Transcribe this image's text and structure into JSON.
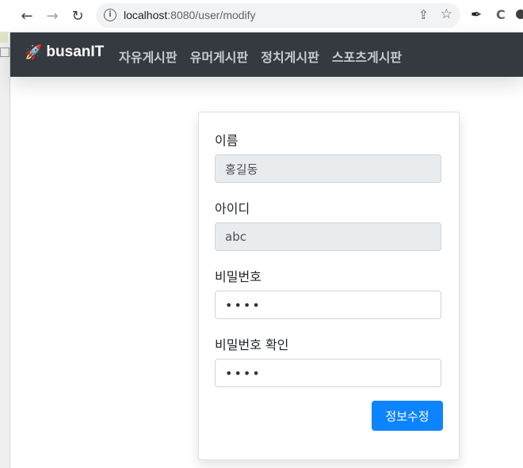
{
  "browser": {
    "url_host": "localhost",
    "url_rest": ":8080/user/modify"
  },
  "navbar": {
    "brand": "busanIT",
    "links": [
      "자유게시판",
      "유머게시판",
      "정치게시판",
      "스포츠게시판"
    ]
  },
  "form": {
    "name_label": "이름",
    "name_value": "홍길동",
    "id_label": "아이디",
    "id_value": "abc",
    "password_label": "비밀번호",
    "password_value": "••••",
    "password_confirm_label": "비밀번호 확인",
    "password_confirm_value": "••••",
    "submit_label": "정보수정"
  }
}
